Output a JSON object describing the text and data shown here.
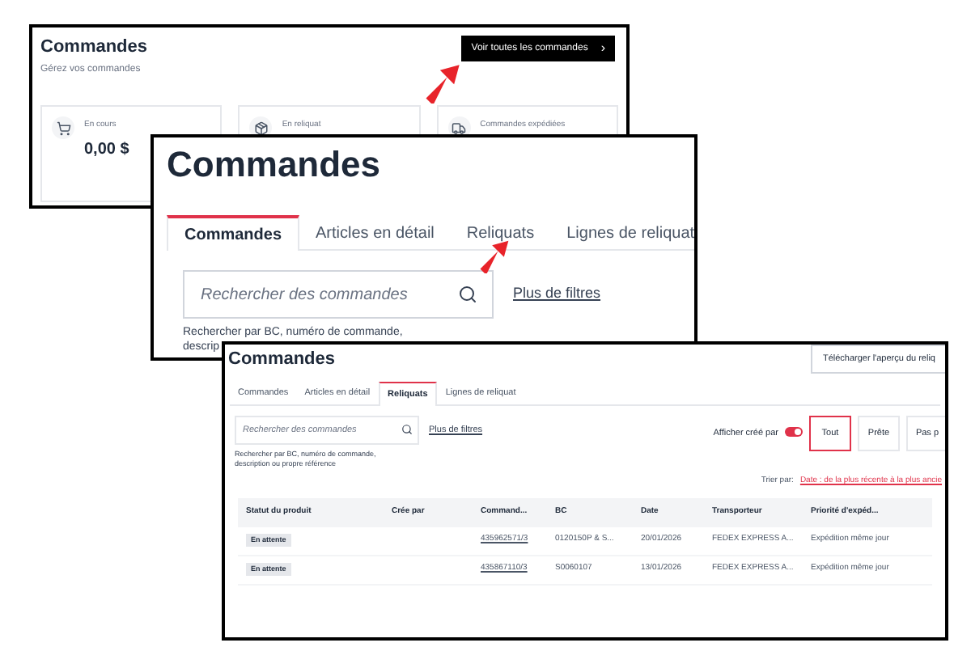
{
  "overview": {
    "title": "Commandes",
    "subtitle": "Gérez vos commandes",
    "button": "Voir toutes les commandes",
    "button_icon": "›",
    "cards": [
      {
        "kind": "cart",
        "label": "En cours",
        "value": "0,00 $"
      },
      {
        "kind": "box",
        "label": "En reliquat"
      },
      {
        "kind": "truck",
        "label": "Commandes expédiées"
      }
    ]
  },
  "orders": {
    "title": "Commandes",
    "tabs": [
      {
        "label": "Commandes",
        "selected": true
      },
      {
        "label": "Articles en détail",
        "selected": false
      },
      {
        "label": "Reliquats",
        "selected": false
      },
      {
        "label": "Lignes de reliquat",
        "selected": false
      }
    ],
    "search": {
      "placeholder": "Rechercher des commandes"
    },
    "more_filters": "Plus de filtres",
    "help": [
      "Rechercher par BC, numéro de commande,",
      "descrip"
    ]
  },
  "backorders": {
    "title": "Commandes",
    "download_button": "Télécharger l'aperçu du reliq",
    "tabs": [
      {
        "label": "Commandes",
        "selected": false
      },
      {
        "label": "Articles en détail",
        "selected": false
      },
      {
        "label": "Reliquats",
        "selected": true
      },
      {
        "label": "Lignes de reliquat",
        "selected": false
      }
    ],
    "search": {
      "placeholder": "Rechercher des commandes"
    },
    "more_filters": "Plus de filtres",
    "help": "Rechercher par BC, numéro de commande, description ou propre référence",
    "show_created_by": {
      "label": "Afficher créé par",
      "on": true
    },
    "filters": [
      {
        "label": "Tout",
        "selected": true
      },
      {
        "label": "Prête",
        "selected": false
      },
      {
        "label": "Pas p",
        "selected": false
      }
    ],
    "sort": {
      "label": "Trier par:",
      "value": "Date : de la plus récente à la plus ancie"
    },
    "table": {
      "columns": [
        "Statut du produit",
        "Crée par",
        "Command...",
        "BC",
        "Date",
        "Transporteur",
        "Priorité d'expéd..."
      ],
      "rows": [
        [
          "En attente",
          "",
          "435962571/3",
          "0120150P & S...",
          "20/01/2026",
          "FEDEX EXPRESS A...",
          "Expédition même jour"
        ],
        [
          "En attente",
          "",
          "435867110/3",
          "S0060107",
          "13/01/2026",
          "FEDEX EXPRESS A...",
          "Expédition même jour"
        ]
      ]
    }
  }
}
